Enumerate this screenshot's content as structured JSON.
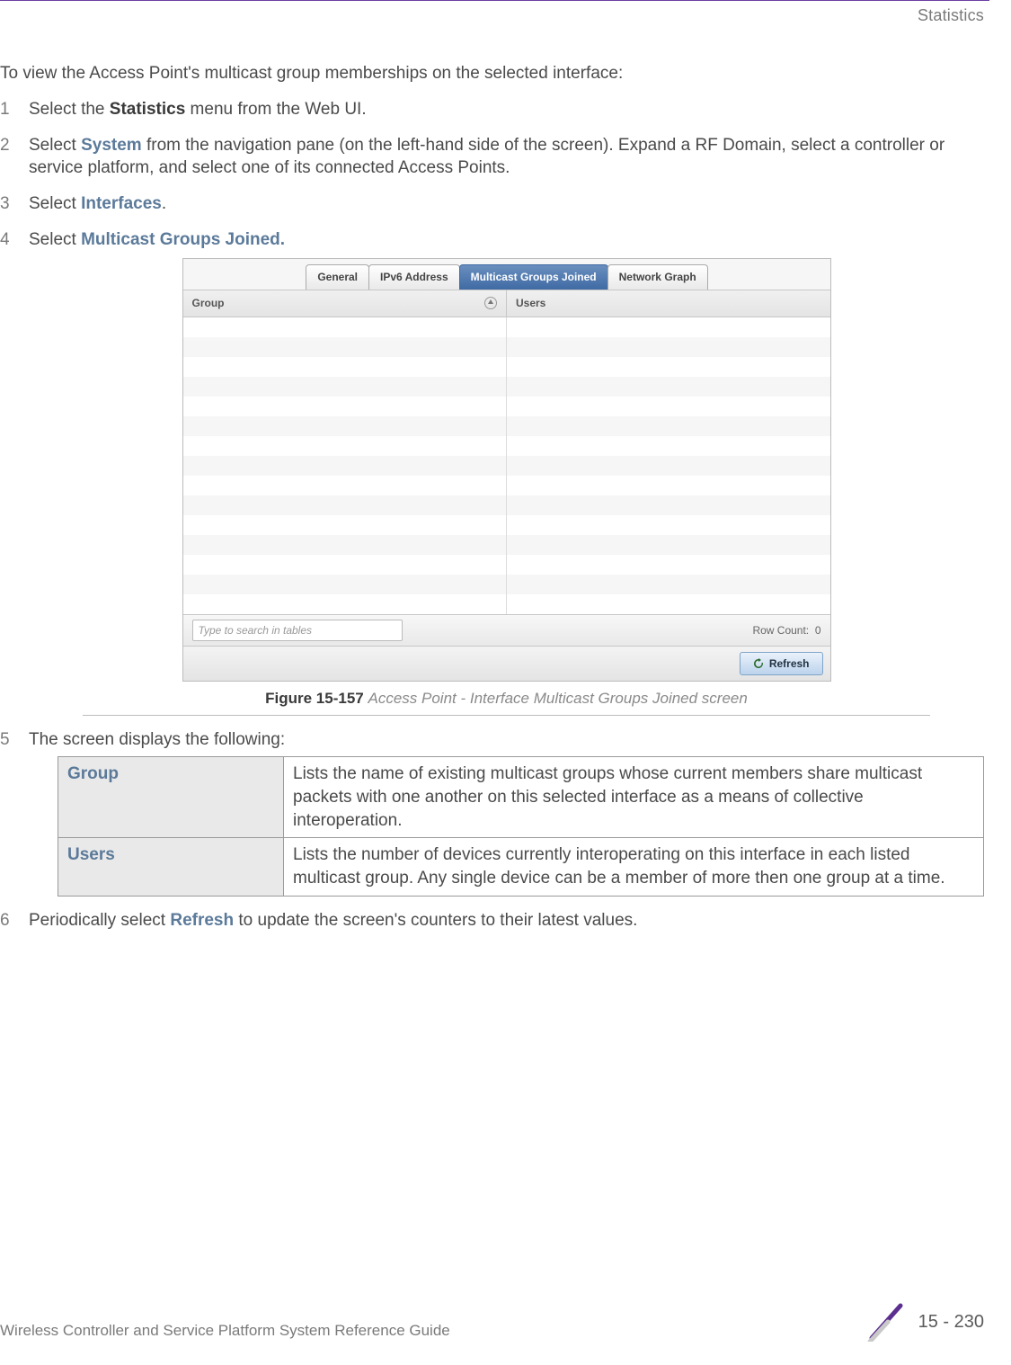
{
  "header": {
    "section": "Statistics"
  },
  "intro": "To view the Access Point's multicast group memberships on the selected interface:",
  "steps": {
    "s1_a": "Select the ",
    "s1_b": "Statistics",
    "s1_c": " menu from the Web UI.",
    "s2_a": "Select ",
    "s2_b": "System",
    "s2_c": " from the navigation pane (on the left-hand side of the screen). Expand a RF Domain, select a controller or service platform, and select one of its connected Access Points.",
    "s3_a": "Select ",
    "s3_b": "Interfaces",
    "s3_c": ".",
    "s4_a": "Select ",
    "s4_b": "Multicast Groups Joined.",
    "s5": "The screen displays the following:",
    "s6_a": "Periodically select ",
    "s6_b": "Refresh",
    "s6_c": " to update the screen's counters to their latest values."
  },
  "screenshot": {
    "tabs": [
      "General",
      "IPv6 Address",
      "Multicast Groups Joined",
      "Network Graph"
    ],
    "active_tab_index": 2,
    "columns": [
      "Group",
      "Users"
    ],
    "search_placeholder": "Type to search in tables",
    "row_count_label": "Row Count:",
    "row_count_value": "0",
    "refresh_label": "Refresh"
  },
  "figure": {
    "number": "Figure 15-157",
    "title": "Access Point - Interface Multicast Groups Joined screen"
  },
  "deftable": [
    {
      "key": "Group",
      "val": "Lists the name of existing multicast groups whose current members share multicast packets with one another on this selected interface as a means of collective interoperation."
    },
    {
      "key": "Users",
      "val": "Lists the number of devices currently interoperating on this interface in each listed multicast group. Any single device can be a member of more then one group at a time."
    }
  ],
  "footer": {
    "guide": "Wireless Controller and Service Platform System Reference Guide",
    "page": "15 - 230"
  }
}
